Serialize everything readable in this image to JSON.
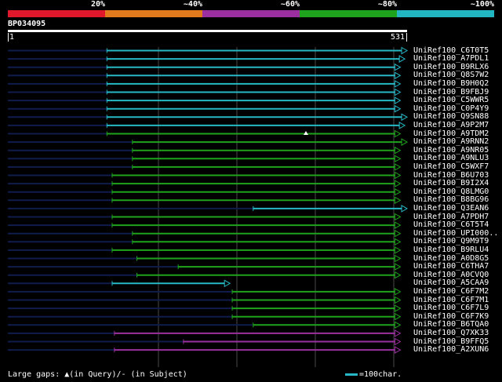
{
  "legend": {
    "labels": [
      "20%",
      "~40%",
      "~60%",
      "~80%",
      "~100%"
    ],
    "colors": [
      "#e0182b",
      "#e07a1d",
      "#9b2fa0",
      "#1fa31c",
      "#21b6c2"
    ]
  },
  "query": {
    "id": "BP034095",
    "start": "1",
    "end": "531",
    "length": 531
  },
  "colors": {
    "cyan": "#27b8c6",
    "green": "#1fa31c",
    "purple": "#9b2fa0",
    "gap": "#0f1d4d",
    "gray": "#4a4a4a"
  },
  "hits": [
    {
      "name": "UniRef100_C6T0T5",
      "start": 132,
      "end": 531,
      "color": "cyan"
    },
    {
      "name": "UniRef100_A7PDL1",
      "start": 132,
      "end": 528,
      "color": "cyan"
    },
    {
      "name": "UniRef100_B9RLX6",
      "start": 132,
      "end": 522,
      "color": "cyan"
    },
    {
      "name": "UniRef100_Q8S7W2",
      "start": 132,
      "end": 522,
      "color": "cyan"
    },
    {
      "name": "UniRef100_B9H0Q2",
      "start": 132,
      "end": 522,
      "color": "cyan"
    },
    {
      "name": "UniRef100_B9FBJ9",
      "start": 132,
      "end": 522,
      "color": "cyan"
    },
    {
      "name": "UniRef100_C5WWR5",
      "start": 132,
      "end": 522,
      "color": "cyan"
    },
    {
      "name": "UniRef100_C0P4Y9",
      "start": 132,
      "end": 522,
      "color": "cyan"
    },
    {
      "name": "UniRef100_Q9SN88",
      "start": 132,
      "end": 531,
      "color": "cyan"
    },
    {
      "name": "UniRef100_A9P2M7",
      "start": 132,
      "end": 528,
      "color": "cyan"
    },
    {
      "name": "UniRef100_A9TDM2",
      "start": 132,
      "end": 522,
      "color": "green"
    },
    {
      "name": "UniRef100_A9RNN2",
      "start": 166,
      "end": 531,
      "color": "green"
    },
    {
      "name": "UniRef100_A9NR05",
      "start": 166,
      "end": 522,
      "color": "green"
    },
    {
      "name": "UniRef100_A9NLU3",
      "start": 166,
      "end": 522,
      "color": "green"
    },
    {
      "name": "UniRef100_C5WXF7",
      "start": 166,
      "end": 522,
      "color": "green"
    },
    {
      "name": "UniRef100_B6U703",
      "start": 139,
      "end": 522,
      "color": "green"
    },
    {
      "name": "UniRef100_B9I2X4",
      "start": 139,
      "end": 522,
      "color": "green"
    },
    {
      "name": "UniRef100_Q8LMG0",
      "start": 139,
      "end": 522,
      "color": "green"
    },
    {
      "name": "UniRef100_B8BG96",
      "start": 139,
      "end": 522,
      "color": "green"
    },
    {
      "name": "UniRef100_Q3EAN6",
      "start": 327,
      "end": 531,
      "color": "cyan"
    },
    {
      "name": "UniRef100_A7PDH7",
      "start": 139,
      "end": 522,
      "color": "green"
    },
    {
      "name": "UniRef100_C6T5T4",
      "start": 139,
      "end": 522,
      "color": "green"
    },
    {
      "name": "UniRef100_UPI000..",
      "start": 166,
      "end": 522,
      "color": "green"
    },
    {
      "name": "UniRef100_Q9M9T9",
      "start": 166,
      "end": 522,
      "color": "green"
    },
    {
      "name": "UniRef100_B9RLU4",
      "start": 139,
      "end": 522,
      "color": "green"
    },
    {
      "name": "UniRef100_A0D8G5",
      "start": 172,
      "end": 522,
      "color": "green"
    },
    {
      "name": "UniRef100_C6THA7",
      "start": 227,
      "end": 522,
      "color": "green"
    },
    {
      "name": "UniRef100_A0CVQ0",
      "start": 172,
      "end": 522,
      "color": "green"
    },
    {
      "name": "UniRef100_A5CAA9",
      "start": 139,
      "end": 295,
      "color": "cyan"
    },
    {
      "name": "UniRef100_C6F7M2",
      "start": 299,
      "end": 522,
      "color": "green"
    },
    {
      "name": "UniRef100_C6F7M1",
      "start": 299,
      "end": 522,
      "color": "green"
    },
    {
      "name": "UniRef100_C6F7L9",
      "start": 299,
      "end": 522,
      "color": "green"
    },
    {
      "name": "UniRef100_C6F7K9",
      "start": 299,
      "end": 522,
      "color": "green"
    },
    {
      "name": "UniRef100_B6TQA0",
      "start": 327,
      "end": 522,
      "color": "green"
    },
    {
      "name": "UniRef100_Q7XK33",
      "start": 142,
      "end": 522,
      "color": "purple"
    },
    {
      "name": "UniRef100_B9FFQ5",
      "start": 234,
      "end": 522,
      "color": "purple"
    },
    {
      "name": "UniRef100_A2XUN6",
      "start": 142,
      "end": 522,
      "color": "purple"
    }
  ],
  "footer": {
    "gaps_text": "Large gaps: ▲(in Query)/- (in Subject)",
    "scale_text": "=100char."
  }
}
